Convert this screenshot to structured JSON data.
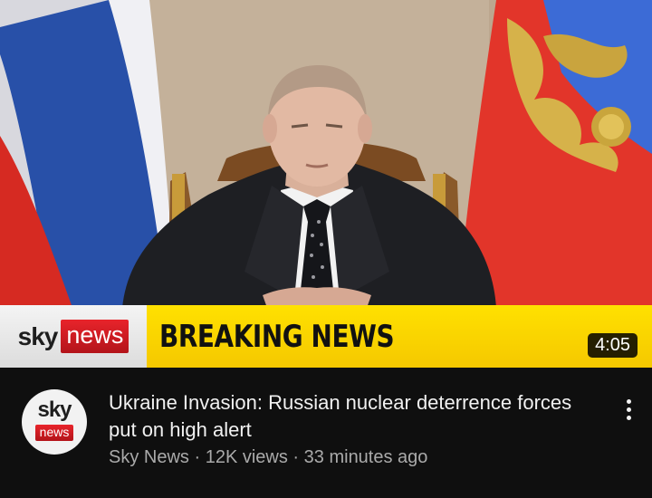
{
  "thumbnail": {
    "lower_third": {
      "brand_sky": "sky",
      "brand_news": "news",
      "headline": "BREAKING NEWS",
      "accent_yellow": "#ffe100",
      "accent_red": "#e8242b"
    },
    "duration": "4:05"
  },
  "video": {
    "channel_avatar": {
      "sky": "sky",
      "news": "news"
    },
    "title": "Ukraine Invasion: Russian nuclear deterrence forces put on high alert",
    "channel": "Sky News",
    "views": "12K views",
    "age": "33 minutes ago",
    "separator": "·",
    "menu_icon": "more-vert-icon"
  }
}
